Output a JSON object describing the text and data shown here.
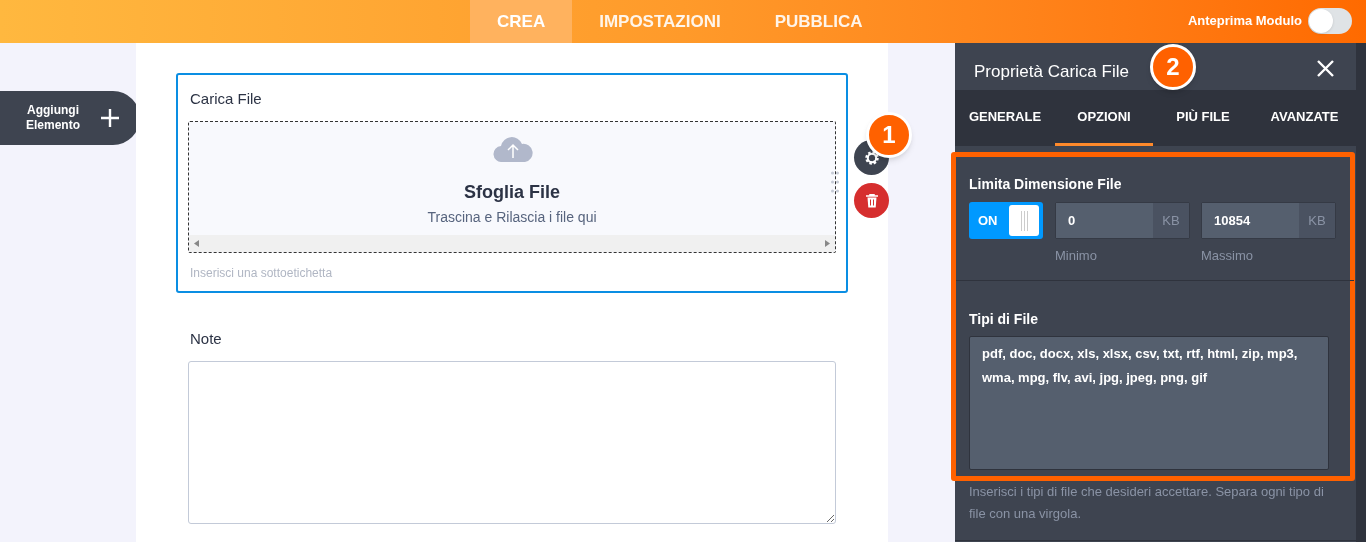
{
  "header": {
    "tabs": [
      {
        "label": "CREA",
        "selected": true
      },
      {
        "label": "IMPOSTAZIONI",
        "selected": false
      },
      {
        "label": "PUBBLICA",
        "selected": false
      }
    ],
    "preview_toggle": {
      "label": "Anteprima Modulo",
      "on": false
    }
  },
  "sidebar": {
    "add_button": "Aggiungi Elemento"
  },
  "form": {
    "upload_field": {
      "label": "Carica File",
      "selected": true,
      "browse": "Sfoglia File",
      "hint": "Trascina e Rilascia i file qui",
      "sublabel": "Inserisci una sottoetichetta"
    },
    "note_field": {
      "label": "Note"
    }
  },
  "callouts": [
    "1",
    "2"
  ],
  "panel": {
    "title": "Proprietà Carica File",
    "tabs": [
      {
        "label": "GENERALE",
        "selected": false
      },
      {
        "label": "OPZIONI",
        "selected": true
      },
      {
        "label": "PIÙ FILE",
        "selected": false
      },
      {
        "label": "AVANZATE",
        "selected": false
      }
    ],
    "size_limit": {
      "label": "Limita Dimensione File",
      "toggle": {
        "label": "ON",
        "on": true
      },
      "min": {
        "value": "0",
        "unit": "KB",
        "caption": "Minimo"
      },
      "max": {
        "value": "10854",
        "unit": "KB",
        "caption": "Massimo"
      }
    },
    "file_types": {
      "label": "Tipi di File",
      "value": "pdf, doc, docx, xls, xlsx, csv, txt, rtf, html, zip, mp3, wma, mpg, flv, avi, jpg, jpeg, png, gif",
      "help": "Inserisci i tipi di file che desideri accettare. Separa ogni tipo di file con una virgola."
    }
  }
}
